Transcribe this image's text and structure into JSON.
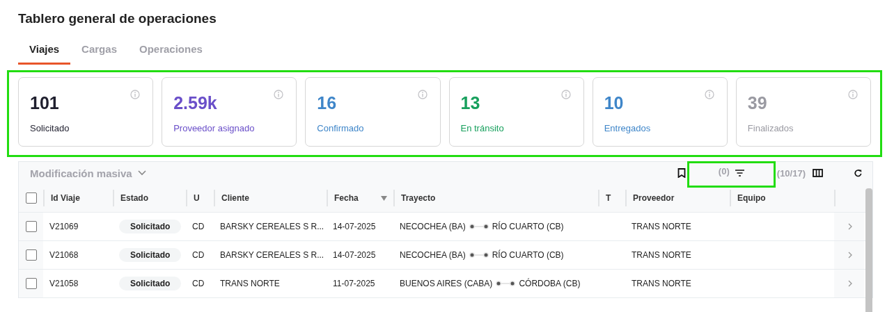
{
  "title": "Tablero general de operaciones",
  "tabs": [
    {
      "label": "Viajes",
      "selected": true
    },
    {
      "label": "Cargas",
      "selected": false
    },
    {
      "label": "Operaciones",
      "selected": false
    }
  ],
  "stats": {
    "highlighted": true,
    "cards": [
      {
        "value": "101",
        "label": "Solicitado",
        "color": "#1f1f2e"
      },
      {
        "value": "2.59k",
        "label": "Proveedor asignado",
        "color": "#6a4fc9"
      },
      {
        "value": "16",
        "label": "Confirmado",
        "color": "#3f86c9"
      },
      {
        "value": "13",
        "label": "En tránsito",
        "color": "#17a05d"
      },
      {
        "value": "10",
        "label": "Entregados",
        "color": "#3f86c9"
      },
      {
        "value": "39",
        "label": "Finalizados",
        "color": "#9a9aa2"
      }
    ]
  },
  "toolbar": {
    "bulk_action": "Modificación masiva",
    "filter_count": "(0)",
    "filter_highlighted": true,
    "columns_count": "(10/17)"
  },
  "table": {
    "select_all_checked": false,
    "columns": [
      {
        "label": "Id Viaje"
      },
      {
        "label": "Estado"
      },
      {
        "label": "U"
      },
      {
        "label": "Cliente"
      },
      {
        "label": "Fecha",
        "sorted": true
      },
      {
        "label": "Trayecto"
      },
      {
        "label": "T"
      },
      {
        "label": "Proveedor"
      },
      {
        "label": "Equipo"
      }
    ],
    "rows": [
      {
        "checked": false,
        "id": "V21069",
        "status": "Solicitado",
        "u": "CD",
        "client": "BARSKY CEREALES S R...",
        "date": "14-07-2025",
        "origin": "NECOCHEA (BA)",
        "destination": "RÍO CUARTO (CB)",
        "provider": "TRANS NORTE"
      },
      {
        "checked": false,
        "id": "V21068",
        "status": "Solicitado",
        "u": "CD",
        "client": "BARSKY CEREALES S R...",
        "date": "14-07-2025",
        "origin": "NECOCHEA (BA)",
        "destination": "RÍO CUARTO (CB)",
        "provider": "TRANS NORTE"
      },
      {
        "checked": false,
        "id": "V21058",
        "status": "Solicitado",
        "u": "CD",
        "client": "TRANS NORTE",
        "date": "11-07-2025",
        "origin": "BUENOS AIRES (CABA)",
        "destination": "CÓRDOBA (CB)",
        "provider": "TRANS NORTE"
      }
    ]
  }
}
